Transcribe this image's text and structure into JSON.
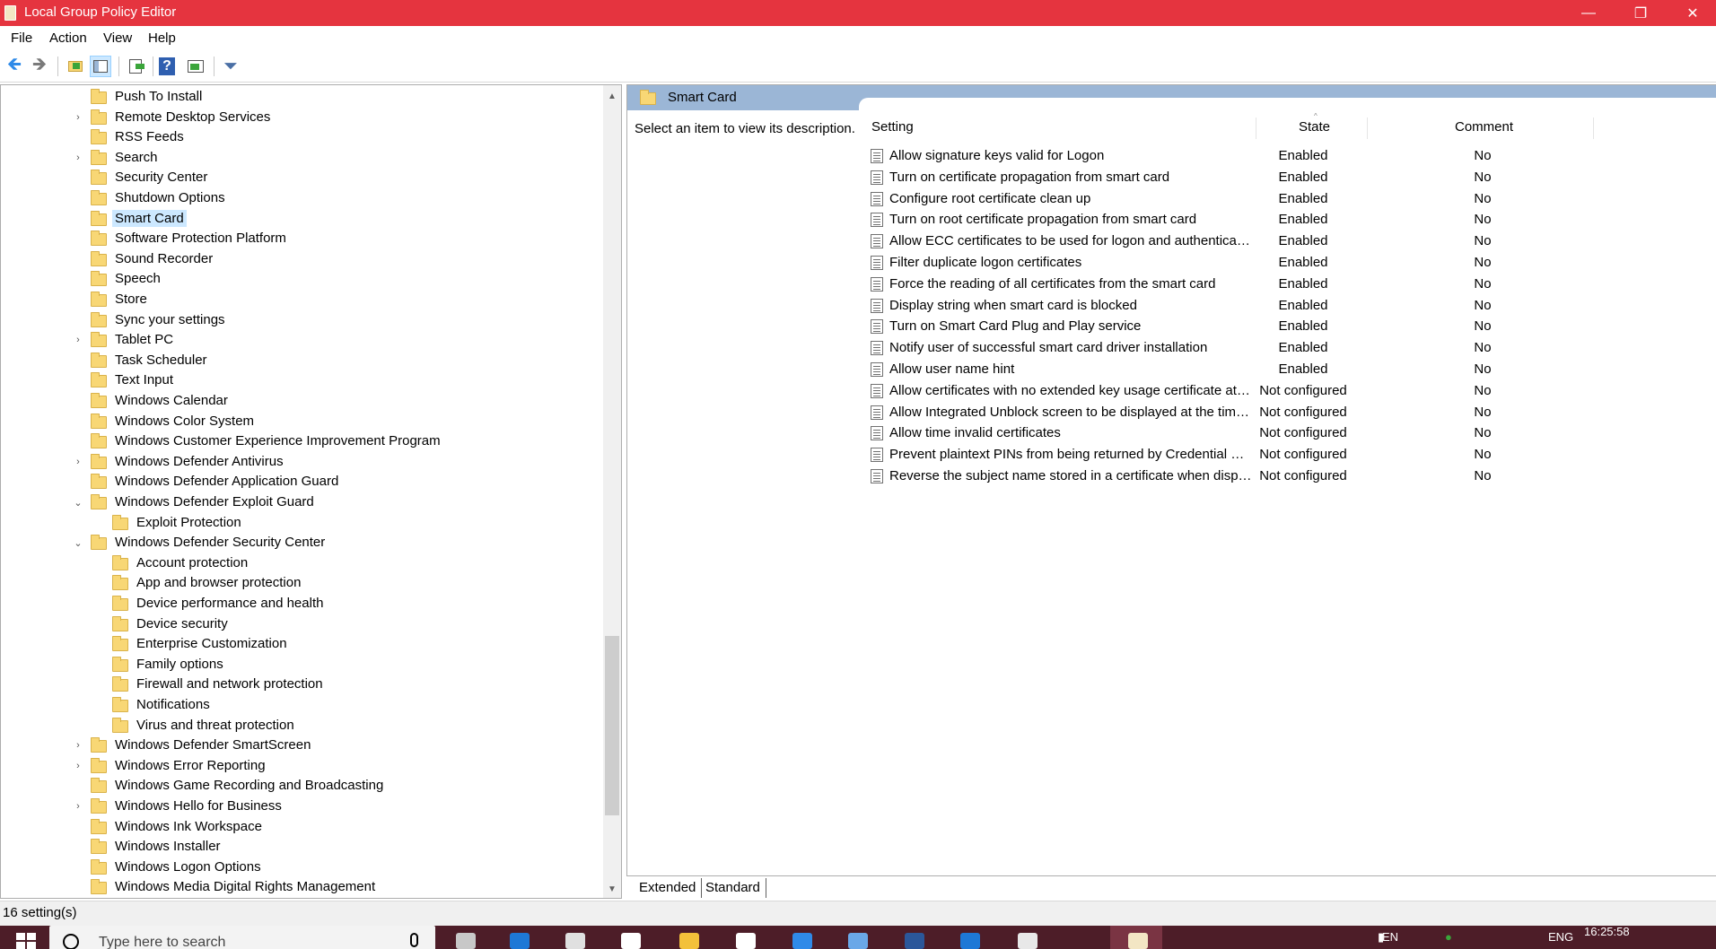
{
  "window": {
    "title": "Local Group Policy Editor",
    "controls": {
      "minimize": "—",
      "maximize": "❐",
      "close": "✕"
    }
  },
  "menu": [
    "File",
    "Action",
    "View",
    "Help"
  ],
  "toolbar": {
    "icons": [
      "back-arrow-icon",
      "forward-arrow-icon",
      "up-folder-icon",
      "show-hide-tree-icon",
      "export-list-icon",
      "help-icon",
      "properties-icon",
      "filter-icon"
    ],
    "glyphs": {
      "back": "🡸",
      "forward": "🡺",
      "help": "?",
      "filter": "⏷"
    }
  },
  "tree": {
    "items": [
      {
        "label": "Push To Install",
        "expander": "",
        "level": 1
      },
      {
        "label": "Remote Desktop Services",
        "expander": "›",
        "level": 1
      },
      {
        "label": "RSS Feeds",
        "expander": "",
        "level": 1
      },
      {
        "label": "Search",
        "expander": "›",
        "level": 1
      },
      {
        "label": "Security Center",
        "expander": "",
        "level": 1
      },
      {
        "label": "Shutdown Options",
        "expander": "",
        "level": 1
      },
      {
        "label": "Smart Card",
        "expander": "",
        "level": 1,
        "selected": true
      },
      {
        "label": "Software Protection Platform",
        "expander": "",
        "level": 1
      },
      {
        "label": "Sound Recorder",
        "expander": "",
        "level": 1
      },
      {
        "label": "Speech",
        "expander": "",
        "level": 1
      },
      {
        "label": "Store",
        "expander": "",
        "level": 1
      },
      {
        "label": "Sync your settings",
        "expander": "",
        "level": 1
      },
      {
        "label": "Tablet PC",
        "expander": "›",
        "level": 1
      },
      {
        "label": "Task Scheduler",
        "expander": "",
        "level": 1
      },
      {
        "label": "Text Input",
        "expander": "",
        "level": 1
      },
      {
        "label": "Windows Calendar",
        "expander": "",
        "level": 1
      },
      {
        "label": "Windows Color System",
        "expander": "",
        "level": 1
      },
      {
        "label": "Windows Customer Experience Improvement Program",
        "expander": "",
        "level": 1
      },
      {
        "label": "Windows Defender Antivirus",
        "expander": "›",
        "level": 1
      },
      {
        "label": "Windows Defender Application Guard",
        "expander": "",
        "level": 1
      },
      {
        "label": "Windows Defender Exploit Guard",
        "expander": "⌄",
        "level": 1
      },
      {
        "label": "Exploit Protection",
        "expander": "",
        "level": 2
      },
      {
        "label": "Windows Defender Security Center",
        "expander": "⌄",
        "level": 1
      },
      {
        "label": "Account protection",
        "expander": "",
        "level": 2
      },
      {
        "label": "App and browser protection",
        "expander": "",
        "level": 2
      },
      {
        "label": "Device performance and health",
        "expander": "",
        "level": 2
      },
      {
        "label": "Device security",
        "expander": "",
        "level": 2
      },
      {
        "label": "Enterprise Customization",
        "expander": "",
        "level": 2
      },
      {
        "label": "Family options",
        "expander": "",
        "level": 2
      },
      {
        "label": "Firewall and network protection",
        "expander": "",
        "level": 2
      },
      {
        "label": "Notifications",
        "expander": "",
        "level": 2
      },
      {
        "label": "Virus and threat protection",
        "expander": "",
        "level": 2
      },
      {
        "label": "Windows Defender SmartScreen",
        "expander": "›",
        "level": 1
      },
      {
        "label": "Windows Error Reporting",
        "expander": "›",
        "level": 1
      },
      {
        "label": "Windows Game Recording and Broadcasting",
        "expander": "",
        "level": 1
      },
      {
        "label": "Windows Hello for Business",
        "expander": "›",
        "level": 1
      },
      {
        "label": "Windows Ink Workspace",
        "expander": "",
        "level": 1
      },
      {
        "label": "Windows Installer",
        "expander": "",
        "level": 1
      },
      {
        "label": "Windows Logon Options",
        "expander": "",
        "level": 1
      },
      {
        "label": "Windows Media Digital Rights Management",
        "expander": "",
        "level": 1
      }
    ],
    "scroll_up": "▲",
    "scroll_down": "▼"
  },
  "details": {
    "header_title": "Smart Card",
    "description": "Select an item to view its description.",
    "columns": {
      "setting": "Setting",
      "state": "State",
      "comment": "Comment"
    },
    "rows": [
      {
        "setting": "Allow signature keys valid for Logon",
        "state": "Enabled",
        "comment": "No"
      },
      {
        "setting": "Turn on certificate propagation from smart card",
        "state": "Enabled",
        "comment": "No"
      },
      {
        "setting": "Configure root certificate clean up",
        "state": "Enabled",
        "comment": "No"
      },
      {
        "setting": "Turn on root certificate propagation from smart card",
        "state": "Enabled",
        "comment": "No"
      },
      {
        "setting": "Allow ECC certificates to be used for logon and authentication",
        "state": "Enabled",
        "comment": "No"
      },
      {
        "setting": "Filter duplicate logon certificates",
        "state": "Enabled",
        "comment": "No"
      },
      {
        "setting": "Force the reading of all certificates from the smart card",
        "state": "Enabled",
        "comment": "No"
      },
      {
        "setting": "Display string when smart card is blocked",
        "state": "Enabled",
        "comment": "No"
      },
      {
        "setting": "Turn on Smart Card Plug and Play service",
        "state": "Enabled",
        "comment": "No"
      },
      {
        "setting": "Notify user of successful smart card driver installation",
        "state": "Enabled",
        "comment": "No"
      },
      {
        "setting": "Allow user name hint",
        "state": "Enabled",
        "comment": "No"
      },
      {
        "setting": "Allow certificates with no extended key usage certificate attrib...",
        "state": "Not configured",
        "comment": "No"
      },
      {
        "setting": "Allow Integrated Unblock screen to be displayed at the time ...",
        "state": "Not configured",
        "comment": "No"
      },
      {
        "setting": "Allow time invalid certificates",
        "state": "Not configured",
        "comment": "No"
      },
      {
        "setting": "Prevent plaintext PINs from being returned by Credential Ma...",
        "state": "Not configured",
        "comment": "No"
      },
      {
        "setting": "Reverse the subject name stored in a certificate when displayi...",
        "state": "Not configured",
        "comment": "No"
      }
    ],
    "tabs": [
      "Extended",
      "Standard"
    ]
  },
  "status": {
    "text": "16 setting(s)"
  },
  "taskbar": {
    "search_placeholder": "Type here to search",
    "tray": {
      "lang1": "EN",
      "lang2": "ENG"
    },
    "clock": "16:25:58",
    "app_colors": [
      "#c8c8c8",
      "#1e78d6",
      "#e0e0e0",
      "#ffffff",
      "#f3c13a",
      "#ffffff",
      "#2f8ae8",
      "#6aa8e8",
      "#2b579a",
      "#1e78d6",
      "#e8e8e8",
      "#f3e6c4"
    ]
  },
  "colors": {
    "titlebar": "#e5343f",
    "header": "#9bb6d6",
    "selection": "#cce8ff",
    "taskbar": "#4d1d28"
  }
}
